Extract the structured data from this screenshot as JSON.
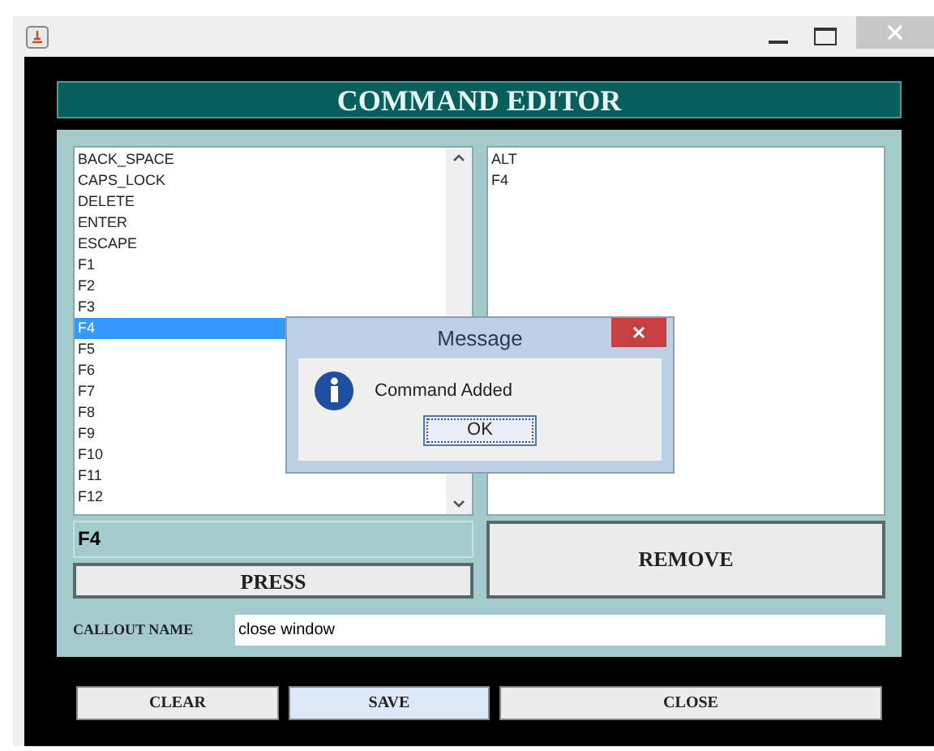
{
  "header": {
    "title": "COMMAND EDITOR"
  },
  "key_list": {
    "items": [
      {
        "label": "BACK_SPACE",
        "selected": false
      },
      {
        "label": "CAPS_LOCK",
        "selected": false
      },
      {
        "label": "DELETE",
        "selected": false
      },
      {
        "label": "ENTER",
        "selected": false
      },
      {
        "label": "ESCAPE",
        "selected": false
      },
      {
        "label": "F1",
        "selected": false
      },
      {
        "label": "F2",
        "selected": false
      },
      {
        "label": "F3",
        "selected": false
      },
      {
        "label": "F4",
        "selected": true
      },
      {
        "label": "F5",
        "selected": false
      },
      {
        "label": "F6",
        "selected": false
      },
      {
        "label": "F7",
        "selected": false
      },
      {
        "label": "F8",
        "selected": false
      },
      {
        "label": "F9",
        "selected": false
      },
      {
        "label": "F10",
        "selected": false
      },
      {
        "label": "F11",
        "selected": false
      },
      {
        "label": "F12",
        "selected": false
      }
    ]
  },
  "command_list": {
    "items": [
      "ALT",
      "F4"
    ]
  },
  "selected_key": "F4",
  "press_button": "PRESS",
  "remove_button": "REMOVE",
  "callout": {
    "label": "CALLOUT NAME",
    "value": "close window"
  },
  "footer_buttons": [
    {
      "label": "CLEAR",
      "focused": false
    },
    {
      "label": "SAVE",
      "focused": true
    },
    {
      "label": "CLOSE",
      "focused": false
    }
  ],
  "dialog": {
    "title": "Message",
    "message": "Command Added",
    "button": "OK"
  }
}
